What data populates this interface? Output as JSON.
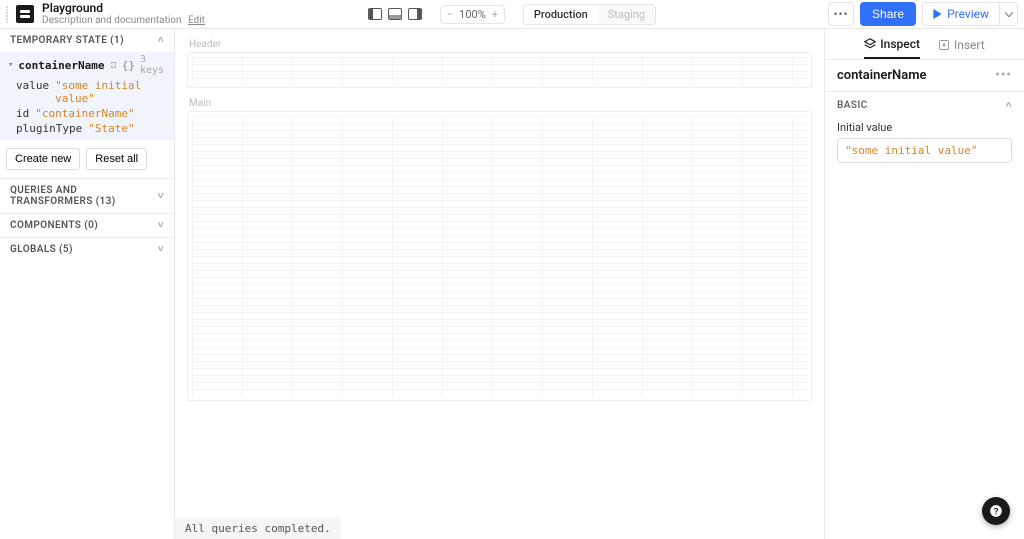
{
  "header": {
    "app_title": "Playground",
    "app_desc": "Description and documentation",
    "edit_label": "Edit",
    "zoom": "100%",
    "env_production": "Production",
    "env_staging": "Staging",
    "share": "Share",
    "preview": "Preview"
  },
  "left": {
    "temp_state_label": "TEMPORARY STATE (1)",
    "tree": {
      "name": "containerName",
      "braces": "{}",
      "keys_meta": "3 keys",
      "value_key": "value",
      "value_val": "\"some initial value\"",
      "id_key": "id",
      "id_val": "\"containerName\"",
      "plugin_key": "pluginType",
      "plugin_val": "\"State\""
    },
    "create_new": "Create new",
    "reset_all": "Reset all",
    "queries_label": "QUERIES AND TRANSFORMERS (13)",
    "components_label": "COMPONENTS (0)",
    "globals_label": "GLOBALS (5)"
  },
  "canvas": {
    "header_label": "Header",
    "main_label": "Main",
    "status": "All queries completed."
  },
  "right": {
    "tab_inspect": "Inspect",
    "tab_insert": "Insert",
    "title": "containerName",
    "section_basic": "BASIC",
    "field_label": "Initial value",
    "field_value": "\"some initial value\""
  }
}
